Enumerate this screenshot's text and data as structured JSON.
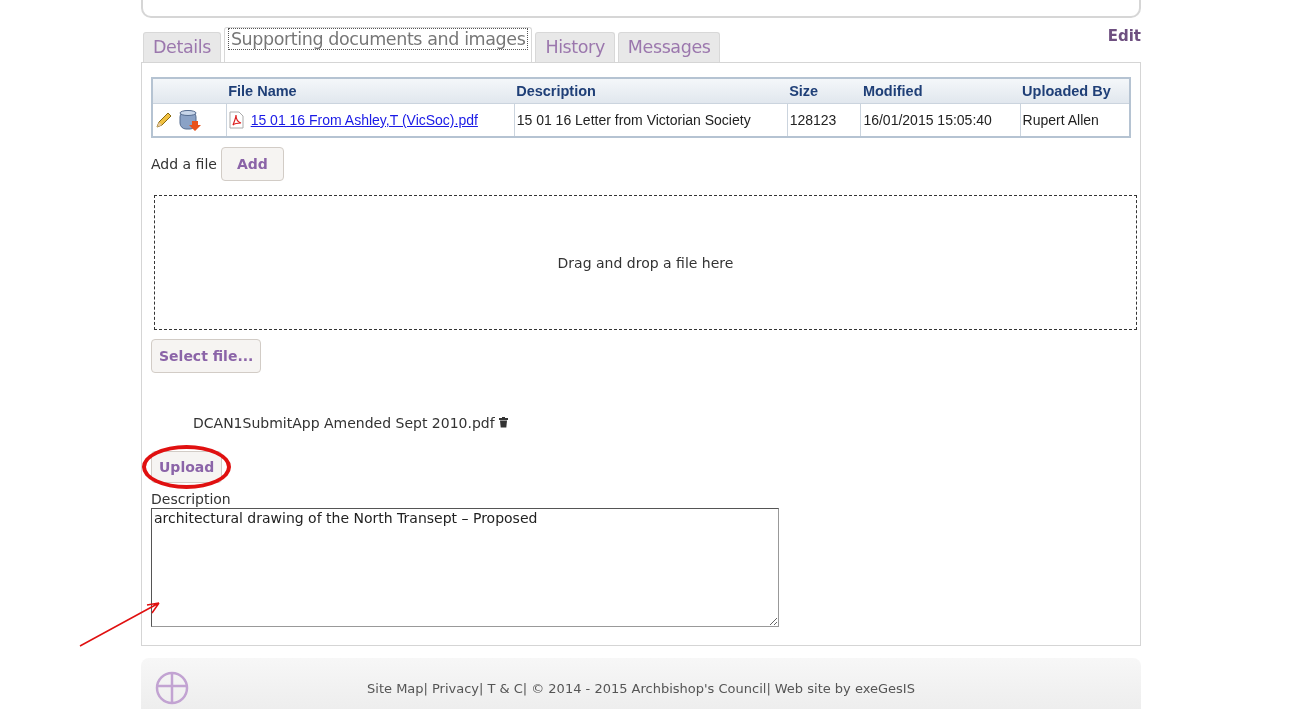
{
  "tabs": [
    {
      "label": "Details",
      "selected": false
    },
    {
      "label": "Supporting documents and images",
      "selected": true
    },
    {
      "label": "History",
      "selected": false
    },
    {
      "label": "Messages",
      "selected": false
    }
  ],
  "edit_link": "Edit",
  "table": {
    "columns": [
      "File Name",
      "Description",
      "Size",
      "Modified",
      "Uploaded By"
    ],
    "rows": [
      {
        "file_name": "15 01 16 From Ashley,T (VicSoc).pdf",
        "description": "15 01 16 Letter from Victorian Society",
        "size": "128123",
        "modified": "16/01/2015 15:05:40",
        "uploaded_by": "Rupert Allen"
      }
    ]
  },
  "add_label": "Add a file",
  "add_button": "Add",
  "drop_zone": "Drag and drop a file here",
  "select_button": "Select file...",
  "pending_file": "DCAN1SubmitApp Amended Sept 2010.pdf",
  "upload_button": "Upload",
  "description_label": "Description",
  "description_value": "architectural drawing of the North Transept – Proposed",
  "footer_links": [
    "Site Map|",
    "Privacy|",
    "T & C|",
    "© 2014 - 2015 Archbishop's Council|",
    "Web site by exeGesIS"
  ]
}
